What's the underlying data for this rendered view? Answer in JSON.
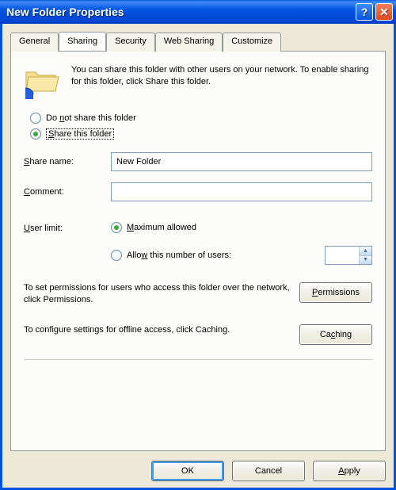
{
  "window": {
    "title": "New Folder Properties",
    "help_btn": "?",
    "close_btn": "✕"
  },
  "tabs": [
    {
      "label": "General"
    },
    {
      "label": "Sharing"
    },
    {
      "label": "Security"
    },
    {
      "label": "Web Sharing"
    },
    {
      "label": "Customize"
    }
  ],
  "intro": "You can share this folder with other users on your network.  To enable sharing for this folder, click Share this folder.",
  "radios": {
    "do_not_share": {
      "prefix": "Do ",
      "uchar": "n",
      "suffix": "ot share this folder"
    },
    "share": {
      "uchar": "S",
      "suffix": "hare this folder"
    }
  },
  "fields": {
    "share_name_label": {
      "uchar": "S",
      "suffix": "hare name:"
    },
    "share_name_value": "New Folder",
    "comment_label": {
      "uchar": "C",
      "suffix": "omment:"
    },
    "comment_value": ""
  },
  "user_limit": {
    "label_prefix": "",
    "label_uchar": "U",
    "label_suffix": "ser limit:",
    "max": {
      "uchar": "M",
      "suffix": "aximum allowed"
    },
    "allow": {
      "prefix": "Allo",
      "uchar": "w",
      "suffix": " this number of users:"
    },
    "spinner_value": ""
  },
  "permissions": {
    "text": "To set permissions for users who access this folder over the network, click Permissions.",
    "btn_uchar": "P",
    "btn_suffix": "ermissions"
  },
  "caching": {
    "text": "To configure settings for offline access, click Caching.",
    "btn_prefix": "Ca",
    "btn_uchar": "c",
    "btn_suffix": "hing"
  },
  "actions": {
    "ok": "OK",
    "cancel": "Cancel",
    "apply_uchar": "A",
    "apply_suffix": "pply"
  }
}
